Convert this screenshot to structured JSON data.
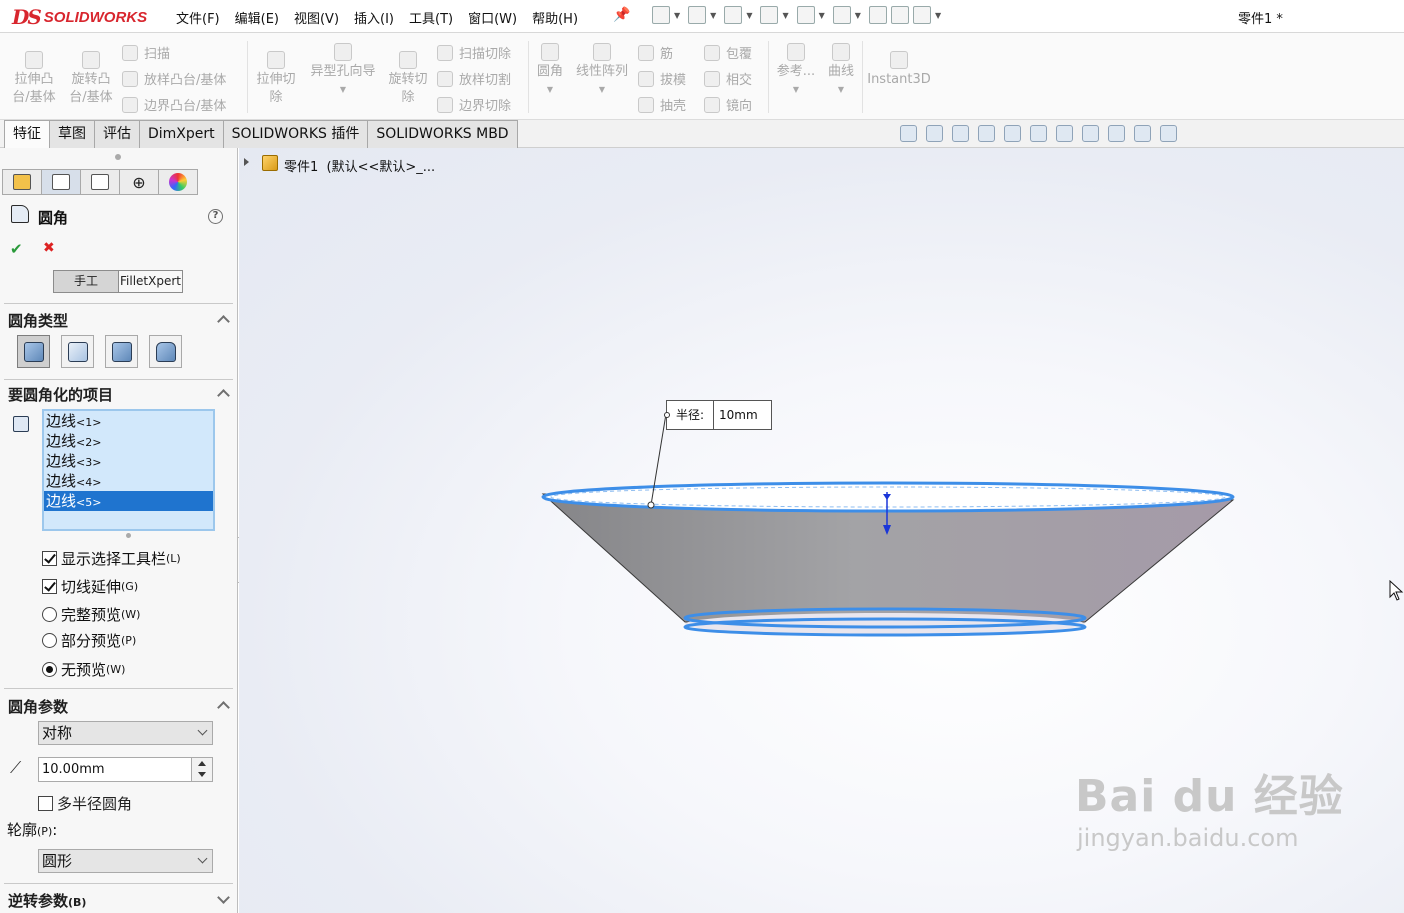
{
  "app": {
    "logo_ds": "DS",
    "logo_text": "SOLIDWORKS",
    "document_title": "零件1 *"
  },
  "menus": [
    "文件(F)",
    "编辑(E)",
    "视图(V)",
    "插入(I)",
    "工具(T)",
    "窗口(W)",
    "帮助(H)"
  ],
  "command_manager": {
    "extrude_boss": [
      "拉伸凸",
      "台/基体"
    ],
    "revolve_boss": [
      "旋转凸",
      "台/基体"
    ],
    "sweep": "扫描",
    "loft_boss": "放样凸台/基体",
    "boundary_boss": "边界凸台/基体",
    "extrude_cut": [
      "拉伸切",
      "除"
    ],
    "hole_wizard": "异型孔向导",
    "revolve_cut": [
      "旋转切",
      "除"
    ],
    "sweep_cut": "扫描切除",
    "loft_cut": "放样切割",
    "boundary_cut": "边界切除",
    "fillet": "圆角",
    "linear_pattern": "线性阵列",
    "rib": "筋",
    "draft": "拔模",
    "shell": "抽壳",
    "wrap": "包覆",
    "intersect": "相交",
    "mirror": "镜向",
    "reference": "参考...",
    "curves": "曲线",
    "instant3d": "Instant3D"
  },
  "tabs": [
    {
      "label": "特征",
      "active": true
    },
    {
      "label": "草图",
      "active": false
    },
    {
      "label": "评估",
      "active": false
    },
    {
      "label": "DimXpert",
      "active": false
    },
    {
      "label": "SOLIDWORKS 插件",
      "active": false
    },
    {
      "label": "SOLIDWORKS MBD",
      "active": false
    }
  ],
  "property_manager": {
    "title": "圆角",
    "help": "?",
    "mode_manual": "手工",
    "mode_xpert": "FilletXpert",
    "fillet_type_header": "圆角类型",
    "items_header": "要圆角化的项目",
    "edges": [
      {
        "name": "边线",
        "index": "<1>",
        "selected": false
      },
      {
        "name": "边线",
        "index": "<2>",
        "selected": false
      },
      {
        "name": "边线",
        "index": "<3>",
        "selected": false
      },
      {
        "name": "边线",
        "index": "<4>",
        "selected": false
      },
      {
        "name": "边线",
        "index": "<5>",
        "selected": true
      }
    ],
    "options": [
      {
        "type": "checkbox",
        "label": "显示选择工具栏",
        "shortcut": "(L)",
        "checked": true
      },
      {
        "type": "checkbox",
        "label": "切线延伸",
        "shortcut": "(G)",
        "checked": true
      },
      {
        "type": "radio",
        "label": "完整预览",
        "shortcut": "(W)",
        "checked": false
      },
      {
        "type": "radio",
        "label": "部分预览",
        "shortcut": "(P)",
        "checked": false
      },
      {
        "type": "radio",
        "label": "无预览",
        "shortcut": "(W)",
        "checked": true
      }
    ],
    "params_header": "圆角参数",
    "symmetry_value": "对称",
    "radius_value": "10.00mm",
    "multi_radius_label": "多半径圆角",
    "multi_radius_checked": false,
    "profile_label": "轮廓",
    "profile_shortcut": "(P)",
    "profile_colon": ":",
    "profile_value": "圆形",
    "reverse_header": "逆转参数",
    "reverse_shortcut": "(B)"
  },
  "viewport": {
    "tree_part": "零件1",
    "tree_config": "(默认<<默认>_...",
    "callout_label": "半径:",
    "callout_value": "10mm",
    "watermark_main": "Bai du 经验",
    "watermark_url": "jingyan.baidu.com",
    "colors": {
      "edge_highlight": "#3d8ee8",
      "body": "#9a9a9c",
      "selection": "#1f74cf"
    }
  }
}
